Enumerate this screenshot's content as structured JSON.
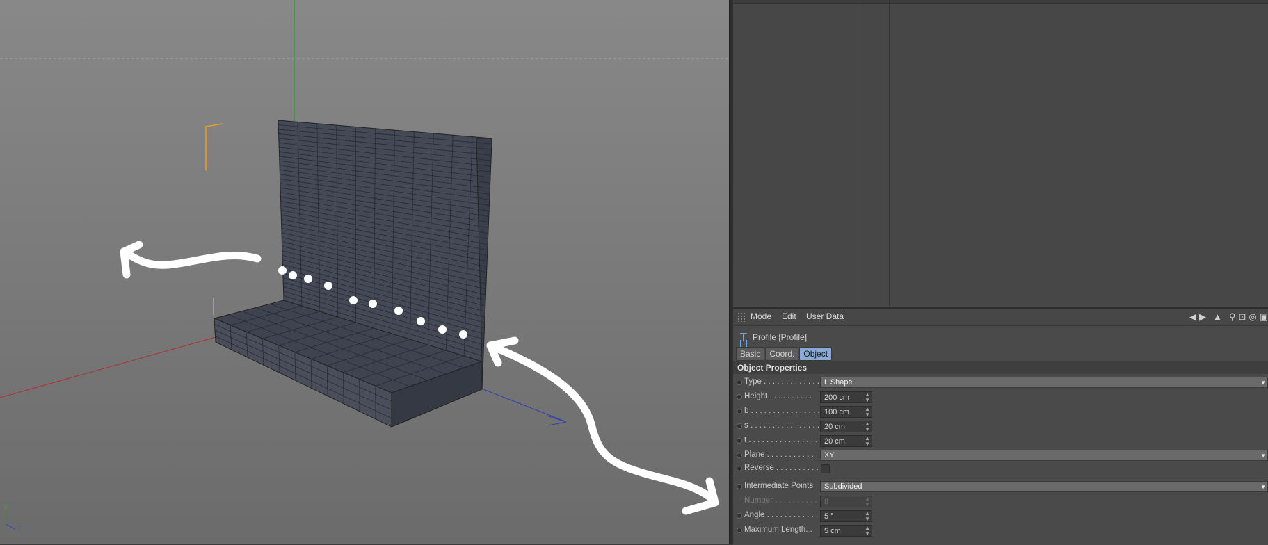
{
  "menu": {
    "mode": "Mode",
    "edit": "Edit",
    "user_data": "User Data"
  },
  "object": {
    "title": "Profile [Profile]"
  },
  "tabs": [
    "Basic",
    "Coord.",
    "Object"
  ],
  "active_tab": "Object",
  "section_title": "Object Properties",
  "params": {
    "type": {
      "label": "Type . . . . . . . . . . . . .",
      "value": "L Shape"
    },
    "height": {
      "label": "Height  . . . . . . . . . .",
      "value": "200 cm"
    },
    "b": {
      "label": "b . . . . . . . . . . . . . . . .",
      "value": "100 cm"
    },
    "s": {
      "label": "s . . . . . . . . . . . . . . . .",
      "value": "20 cm"
    },
    "t": {
      "label": "t  . . . . . . . . . . . . . . . .",
      "value": "20 cm"
    },
    "plane": {
      "label": "Plane  . . . . . . . . . . . .",
      "value": "XY"
    },
    "reverse": {
      "label": "Reverse  . . . . . . . . . .",
      "value": false
    },
    "intermediate": {
      "label": "Intermediate Points",
      "value": "Subdivided"
    },
    "number": {
      "label": "Number . . . . . . . . . . .",
      "value": "8"
    },
    "angle": {
      "label": "Angle  . . . . . . . . . . . .",
      "value": "5 °"
    },
    "maxlen": {
      "label": "Maximum Length. .",
      "value": "5 cm"
    }
  },
  "viewport_axis": {
    "y": "Y",
    "z": "Z"
  },
  "colors": {
    "accent_tab": "#8ba9d6",
    "x_axis": "#b03030",
    "y_axis": "#2e8b2e",
    "z_axis": "#3040b0",
    "selection": "#e0a030"
  }
}
